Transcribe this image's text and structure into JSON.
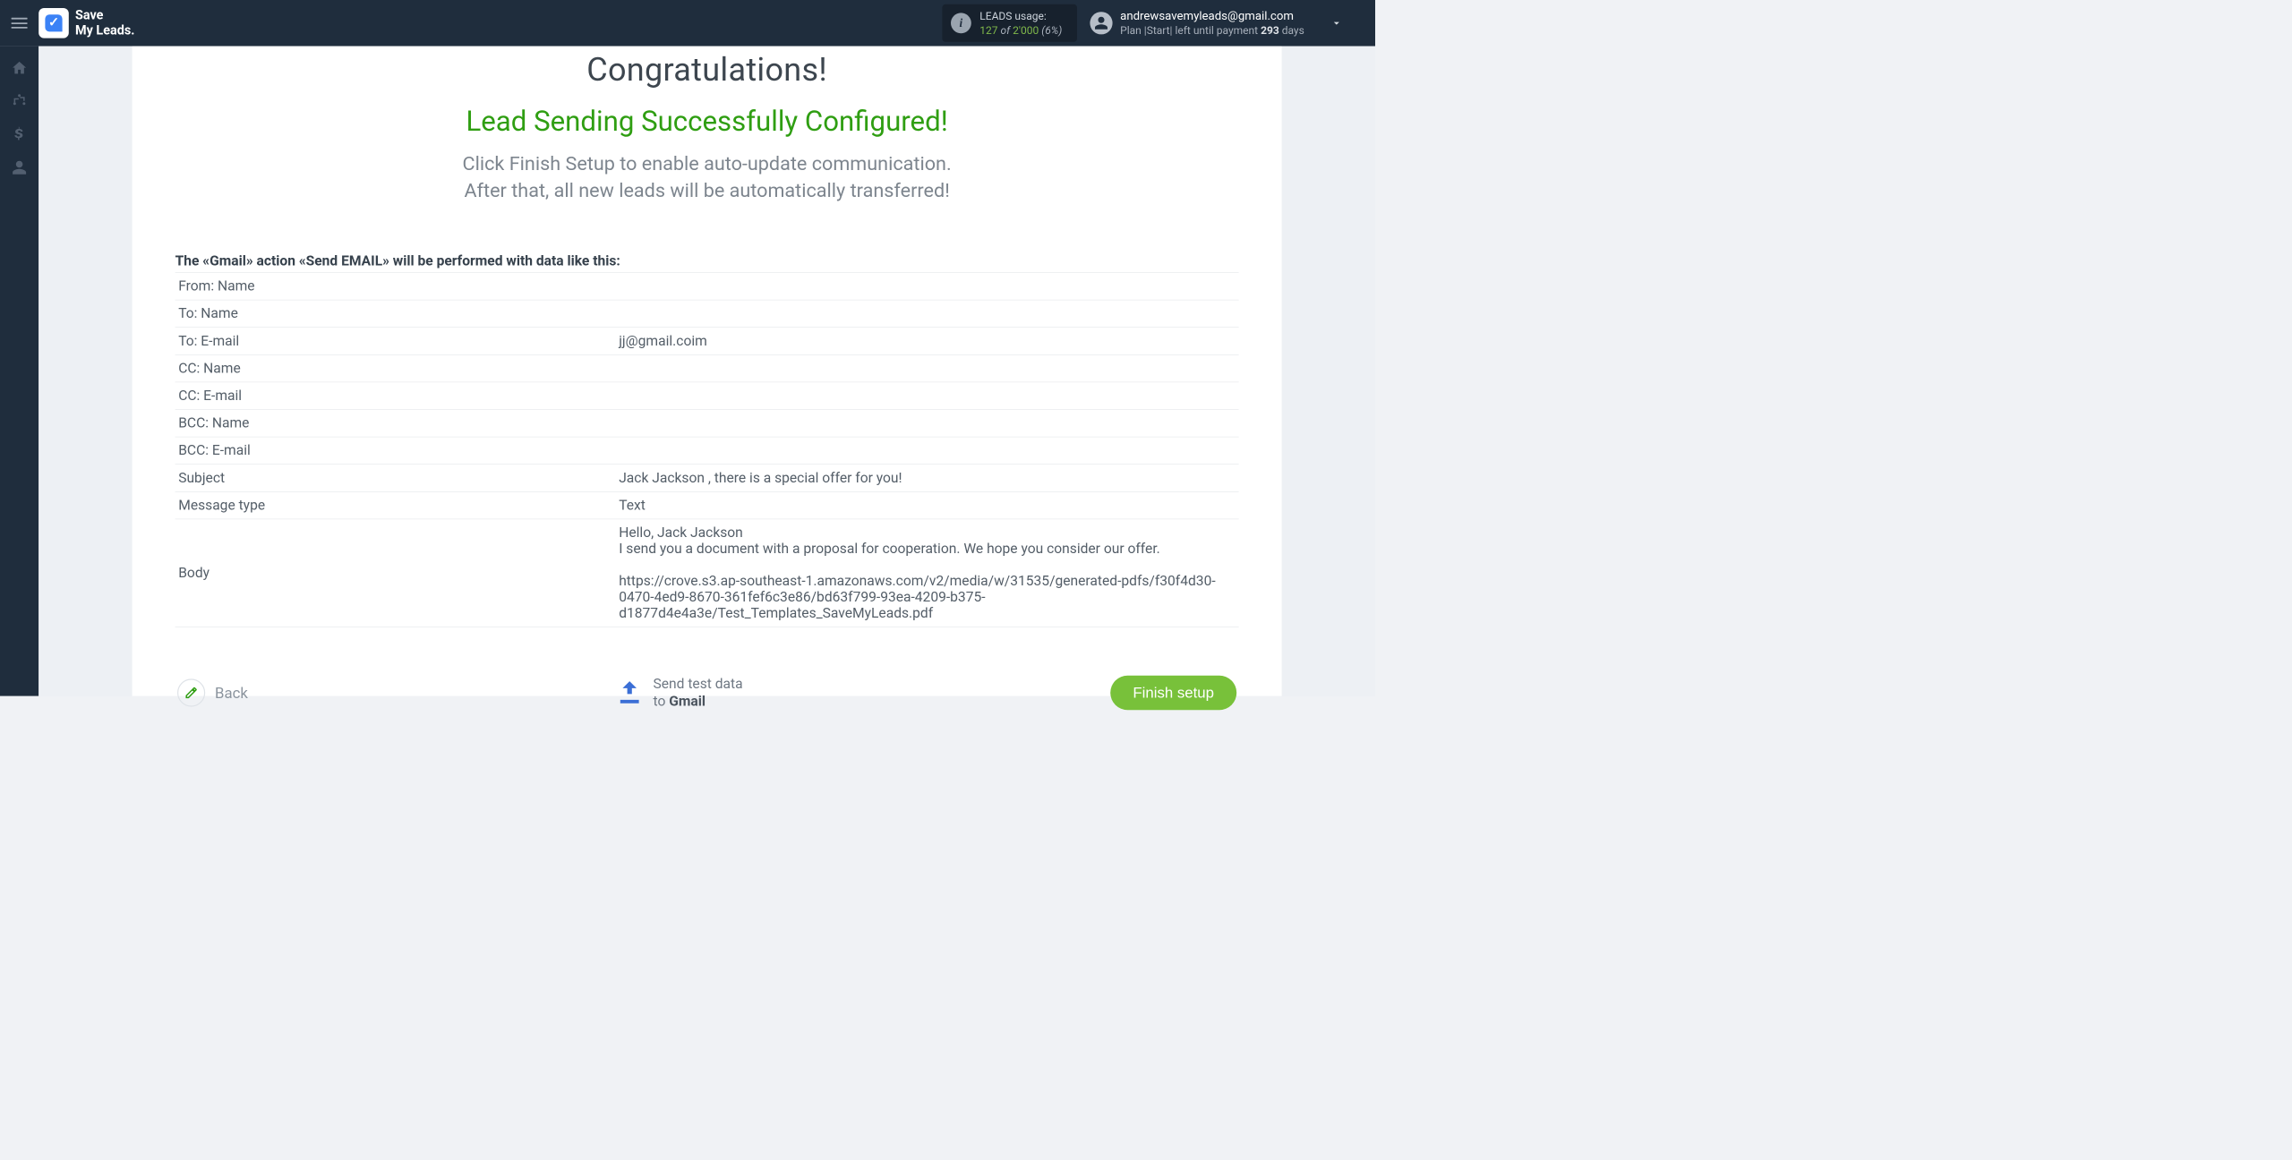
{
  "header": {
    "logo_line1": "Save",
    "logo_line2": "My Leads.",
    "usage_label": "LEADS usage:",
    "usage_used": "127",
    "usage_of": "of",
    "usage_total": "2'000",
    "usage_pct": "(6%)",
    "user_email": "andrewsavemyleads@gmail.com",
    "plan_prefix": "Plan |",
    "plan_name": "Start",
    "plan_suffix": "| left until payment ",
    "days_left": "293",
    "days_word": " days"
  },
  "main": {
    "congrats": "Congratulations!",
    "success": "Lead Sending Successfully Configured!",
    "instr_line1": "Click Finish Setup to enable auto-update communication.",
    "instr_line2": "After that, all new leads will be automatically transferred!",
    "preview_title": "The «Gmail» action «Send EMAIL» will be performed with data like this:",
    "rows": [
      {
        "label": "From: Name",
        "value": ""
      },
      {
        "label": "To: Name",
        "value": ""
      },
      {
        "label": "To: E-mail",
        "value": "jj@gmail.coim"
      },
      {
        "label": "CC: Name",
        "value": ""
      },
      {
        "label": "CC: E-mail",
        "value": ""
      },
      {
        "label": "BCC: Name",
        "value": ""
      },
      {
        "label": "BCC: E-mail",
        "value": ""
      },
      {
        "label": "Subject",
        "value": "Jack Jackson , there is a special offer for you!"
      },
      {
        "label": "Message type",
        "value": "Text"
      },
      {
        "label": "Body",
        "value": "Hello, Jack Jackson\nI send you a document with a proposal for cooperation. We hope you consider our offer.\n\nhttps://crove.s3.ap-southeast-1.amazonaws.com/v2/media/w/31535/generated-pdfs/f30f4d30-0470-4ed9-8670-361fef6c3e86/bd63f799-93ea-4209-b375-d1877d4e4a3e/Test_Templates_SaveMyLeads.pdf"
      }
    ]
  },
  "footer": {
    "back": "Back",
    "send_test_line1": "Send test data",
    "send_test_to": "to ",
    "send_test_dest": "Gmail",
    "finish": "Finish setup"
  }
}
